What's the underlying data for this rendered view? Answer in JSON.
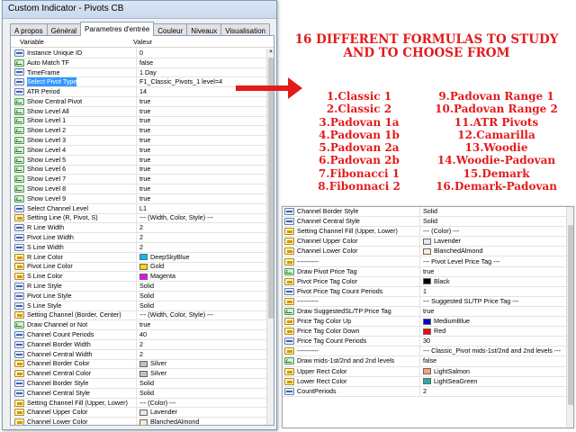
{
  "window": {
    "title": "Custom Indicator - Pivots CB"
  },
  "tabs": [
    "A propos",
    "Général",
    "Parametres d'entrée",
    "Couleur",
    "Niveaux",
    "Visualisation"
  ],
  "active_tab": 2,
  "grid": {
    "col_variable": "Variable",
    "col_value": "Valeur"
  },
  "left_rows": [
    {
      "icon": "n",
      "name": "Instance Unique ID",
      "value": "0"
    },
    {
      "icon": "g",
      "name": "Auto Match TF",
      "value": "false"
    },
    {
      "icon": "n",
      "name": "TimeFrame",
      "value": "1 Day"
    },
    {
      "icon": "n",
      "name": "Select Pivot Type",
      "value": "F1_Classic_Pivots_1 level=4",
      "selected": true
    },
    {
      "icon": "n",
      "name": "ATR Period",
      "value": "14"
    },
    {
      "icon": "g",
      "name": "Show Central Pivot",
      "value": "true"
    },
    {
      "icon": "g",
      "name": "Show Level All",
      "value": "true"
    },
    {
      "icon": "g",
      "name": "Show Level 1",
      "value": "true"
    },
    {
      "icon": "g",
      "name": "Show Level 2",
      "value": "true"
    },
    {
      "icon": "g",
      "name": "Show Level 3",
      "value": "true"
    },
    {
      "icon": "g",
      "name": "Show Level 4",
      "value": "true"
    },
    {
      "icon": "g",
      "name": "Show Level 5",
      "value": "true"
    },
    {
      "icon": "g",
      "name": "Show Level 6",
      "value": "true"
    },
    {
      "icon": "g",
      "name": "Show Level 7",
      "value": "true"
    },
    {
      "icon": "g",
      "name": "Show Level 8",
      "value": "true"
    },
    {
      "icon": "g",
      "name": "Show Level 9",
      "value": "true"
    },
    {
      "icon": "n",
      "name": "Select Channel Level",
      "value": "L1"
    },
    {
      "icon": "y",
      "name": "Setting Line (R, Pivot, S)",
      "value": "--- (Width, Color, Style) ---"
    },
    {
      "icon": "n",
      "name": "R Line Width",
      "value": "2"
    },
    {
      "icon": "n",
      "name": "Pivot Line Width",
      "value": "2"
    },
    {
      "icon": "n",
      "name": "S Line Width",
      "value": "2"
    },
    {
      "icon": "y",
      "name": "R Line Color",
      "value": "DeepSkyBlue",
      "swatch": "#00bfff"
    },
    {
      "icon": "y",
      "name": "Pivot Line Color",
      "value": "Gold",
      "swatch": "#ffd700"
    },
    {
      "icon": "y",
      "name": "S Line Color",
      "value": "Magenta",
      "swatch": "#ff00ff"
    },
    {
      "icon": "n",
      "name": "R Line Style",
      "value": "Solid"
    },
    {
      "icon": "n",
      "name": "Pivot Line Style",
      "value": "Solid"
    },
    {
      "icon": "n",
      "name": "S Line Style",
      "value": "Solid"
    },
    {
      "icon": "y",
      "name": "Setting Channel (Border, Center)",
      "value": "--- (Width, Color, Style) ---"
    },
    {
      "icon": "g",
      "name": "Draw Channel or Not",
      "value": "true"
    },
    {
      "icon": "n",
      "name": "Channel Count Periods",
      "value": "40"
    },
    {
      "icon": "n",
      "name": "Channel Border Width",
      "value": "2"
    },
    {
      "icon": "n",
      "name": "Channel Central Width",
      "value": "2"
    },
    {
      "icon": "y",
      "name": "Channel Border Color",
      "value": "Silver",
      "swatch": "#c0c0c0"
    },
    {
      "icon": "y",
      "name": "Channel Central Color",
      "value": "Silver",
      "swatch": "#c0c0c0"
    },
    {
      "icon": "n",
      "name": "Channel Border Style",
      "value": "Solid"
    },
    {
      "icon": "n",
      "name": "Channel Central Style",
      "value": "Solid"
    },
    {
      "icon": "y",
      "name": "Setting Channel Fill (Upper, Lower)",
      "value": "--- (Color) ---"
    },
    {
      "icon": "y",
      "name": "Channel Upper Color",
      "value": "Lavender",
      "swatch": "#e6e6fa"
    },
    {
      "icon": "y",
      "name": "Channel Lower Color",
      "value": "BlanchedAlmond",
      "swatch": "#ffebcd"
    }
  ],
  "headline": {
    "line1": "16 DIFFERENT FORMULAS TO STUDY",
    "line2": "AND TO CHOOSE FROM"
  },
  "formulas_left": [
    "1.Classic 1",
    "2.Classic 2",
    "3.Padovan 1a",
    "4.Padovan 1b",
    "5.Padovan 2a",
    "6.Padovan 2b",
    "7.Fibonacci 1",
    "8.Fibonnaci 2"
  ],
  "formulas_right": [
    "9.Padovan Range 1",
    "10.Padovan Range 2",
    "11.ATR Pivots",
    "12.Camarilla",
    "13.Woodie",
    "14.Woodie-Padovan",
    "15.Demark",
    "16.Demark-Padovan"
  ],
  "right_rows": [
    {
      "icon": "n",
      "name": "Channel Border Style",
      "value": "Solid"
    },
    {
      "icon": "n",
      "name": "Channel Central Style",
      "value": "Solid"
    },
    {
      "icon": "y",
      "name": "Setting Channel Fill (Upper, Lower)",
      "value": "--- (Color) ---"
    },
    {
      "icon": "y",
      "name": "Channel Upper Color",
      "value": "Lavender",
      "swatch": "#e6e6fa"
    },
    {
      "icon": "y",
      "name": "Channel Lower Color",
      "value": "BlanchedAlmond",
      "swatch": "#ffebcd"
    },
    {
      "icon": "y",
      "name": "----------",
      "value": "--- Pivot Level Price Tag ---"
    },
    {
      "icon": "g",
      "name": "Draw Pivot Price Tag",
      "value": "true"
    },
    {
      "icon": "y",
      "name": "Pivot Price Tag Color",
      "value": "Black",
      "swatch": "#000000"
    },
    {
      "icon": "n",
      "name": "Pivot Price Tag Count Periods",
      "value": "1"
    },
    {
      "icon": "y",
      "name": "----------",
      "value": "--- Suggested SL/TP Price Tag ---"
    },
    {
      "icon": "g",
      "name": "Draw SuggestedSL/TP Price Tag",
      "value": "true"
    },
    {
      "icon": "y",
      "name": "Price Tag Color Up",
      "value": "MediumBlue",
      "swatch": "#0000cd"
    },
    {
      "icon": "y",
      "name": "Price Tag Color Down",
      "value": "Red",
      "swatch": "#ff0000"
    },
    {
      "icon": "n",
      "name": "Price Tag Count Periods",
      "value": "30"
    },
    {
      "icon": "y",
      "name": "----------",
      "value": "--- Classic_Pivot mids-1st/2nd and 2nd levels ---"
    },
    {
      "icon": "g",
      "name": "Draw mids-1st/2nd and 2nd levels",
      "value": "false"
    },
    {
      "icon": "y",
      "name": "Upper Rect Color",
      "value": "LightSalmon",
      "swatch": "#ffa07a"
    },
    {
      "icon": "y",
      "name": "Lower Rect Color",
      "value": "LightSeaGreen",
      "swatch": "#20b2aa"
    },
    {
      "icon": "n",
      "name": "CountPeriods",
      "value": "2"
    }
  ],
  "colors": {
    "accent_red": "#e31b1b",
    "selection": "#3399ff"
  }
}
